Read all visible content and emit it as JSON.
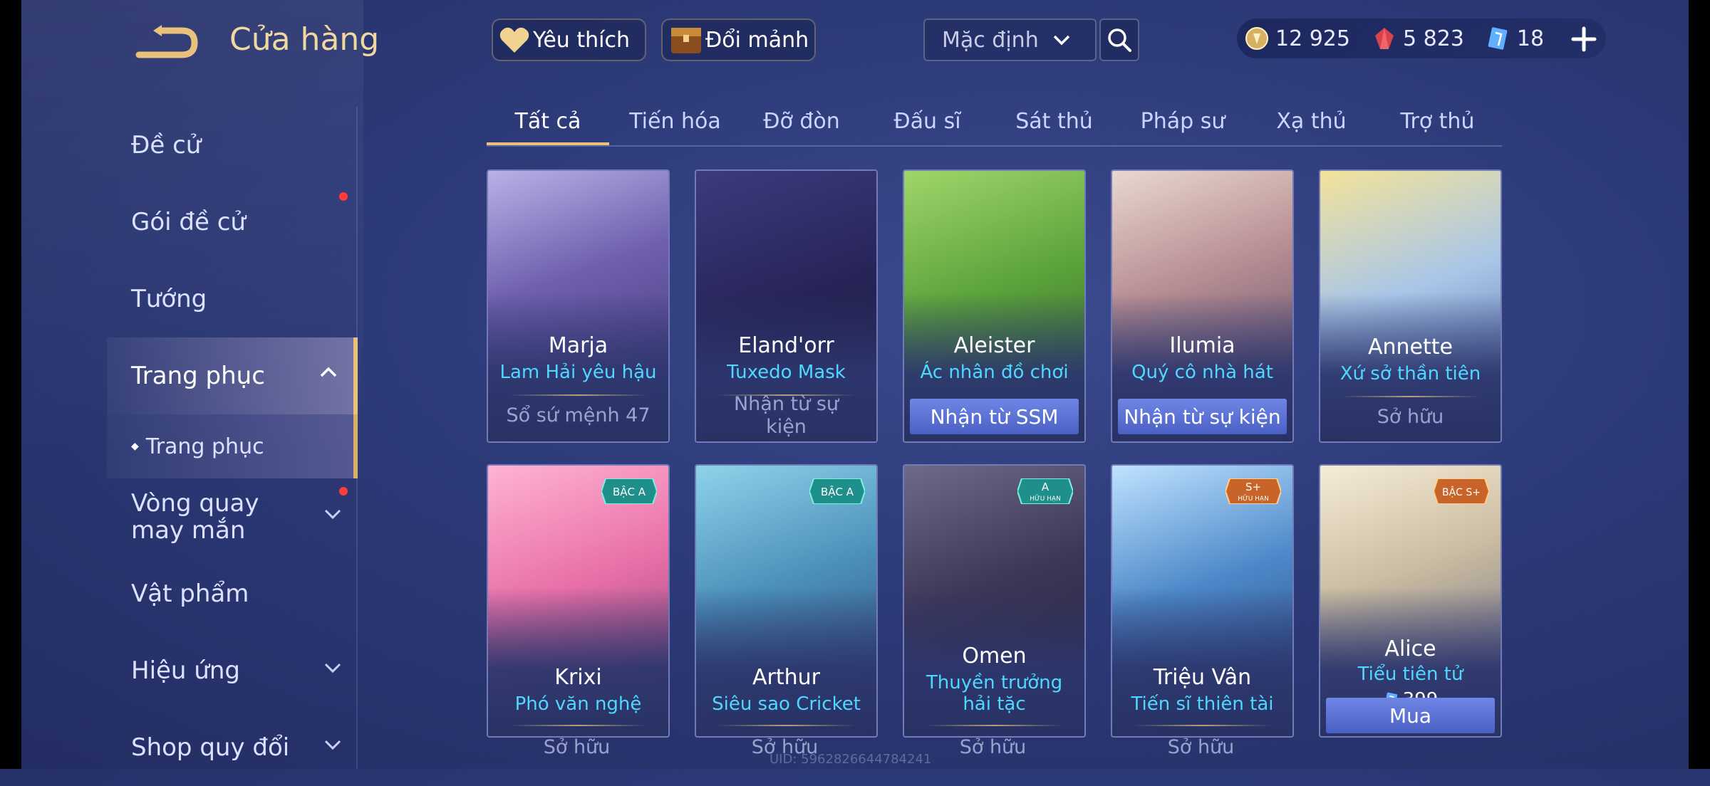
{
  "header": {
    "title": "Cửa hàng"
  },
  "sidebar": {
    "items": [
      {
        "label": "Đề cử"
      },
      {
        "label": "Gói đề cử"
      },
      {
        "label": "Tướng"
      },
      {
        "label": "Trang phục"
      },
      {
        "label": "Trang phục"
      },
      {
        "label": "Vòng quay may mắn"
      },
      {
        "label": "Vật phẩm"
      },
      {
        "label": "Hiệu ứng"
      },
      {
        "label": "Shop quy đổi"
      }
    ]
  },
  "toolbar": {
    "favorite_label": "Yêu thích",
    "exchange_label": "Đổi mảnh",
    "sort_value": "Mặc định"
  },
  "currency": {
    "gold": "12 925",
    "ruby": "5 823",
    "voucher": "18"
  },
  "tabs": [
    {
      "label": "Tất cả"
    },
    {
      "label": "Tiến hóa"
    },
    {
      "label": "Đỡ đòn"
    },
    {
      "label": "Đấu sĩ"
    },
    {
      "label": "Sát thủ"
    },
    {
      "label": "Pháp sư"
    },
    {
      "label": "Xạ thủ"
    },
    {
      "label": "Trợ thủ"
    }
  ],
  "cards": [
    {
      "hero": "Marja",
      "skin": "Lam Hải yêu hậu",
      "status": "Sổ sứ mệnh 47"
    },
    {
      "hero": "Eland'orr",
      "skin": "Tuxedo Mask",
      "status": "Nhận từ sự kiện"
    },
    {
      "hero": "Aleister",
      "skin": "Ác nhân đồ chơi",
      "button": "Nhận từ SSM"
    },
    {
      "hero": "Ilumia",
      "skin": "Quý cô nhà hát",
      "button": "Nhận từ sự kiện"
    },
    {
      "hero": "Annette",
      "skin": "Xứ sở thần tiên",
      "status": "Sở hữu"
    },
    {
      "hero": "Krixi",
      "skin": "Phó văn nghệ",
      "status": "Sở hữu",
      "badge": "BẬC A"
    },
    {
      "hero": "Arthur",
      "skin": "Siêu sao Cricket",
      "status": "Sở hữu",
      "badge": "BẬC A"
    },
    {
      "hero": "Omen",
      "skin": "Thuyền trưởng hải tặc",
      "status": "Sở hữu",
      "badge": "A",
      "badge_sub": "HỮU HẠN"
    },
    {
      "hero": "Triệu Vân",
      "skin": "Tiến sĩ thiên tài",
      "status": "Sở hữu",
      "badge": "S+",
      "badge_sub": "HỮU HẠN"
    },
    {
      "hero": "Alice",
      "skin": "Tiểu tiên tử",
      "price": "399",
      "button": "Mua",
      "badge": "BẬC S+"
    }
  ],
  "footer": {
    "uid": "UID: 5962826644784241"
  },
  "colors": {
    "accent_gold": "#e6c27a",
    "skin_name": "#4fd7ff",
    "button_blue": "#5b72d8",
    "notification": "#ff3b3b"
  }
}
